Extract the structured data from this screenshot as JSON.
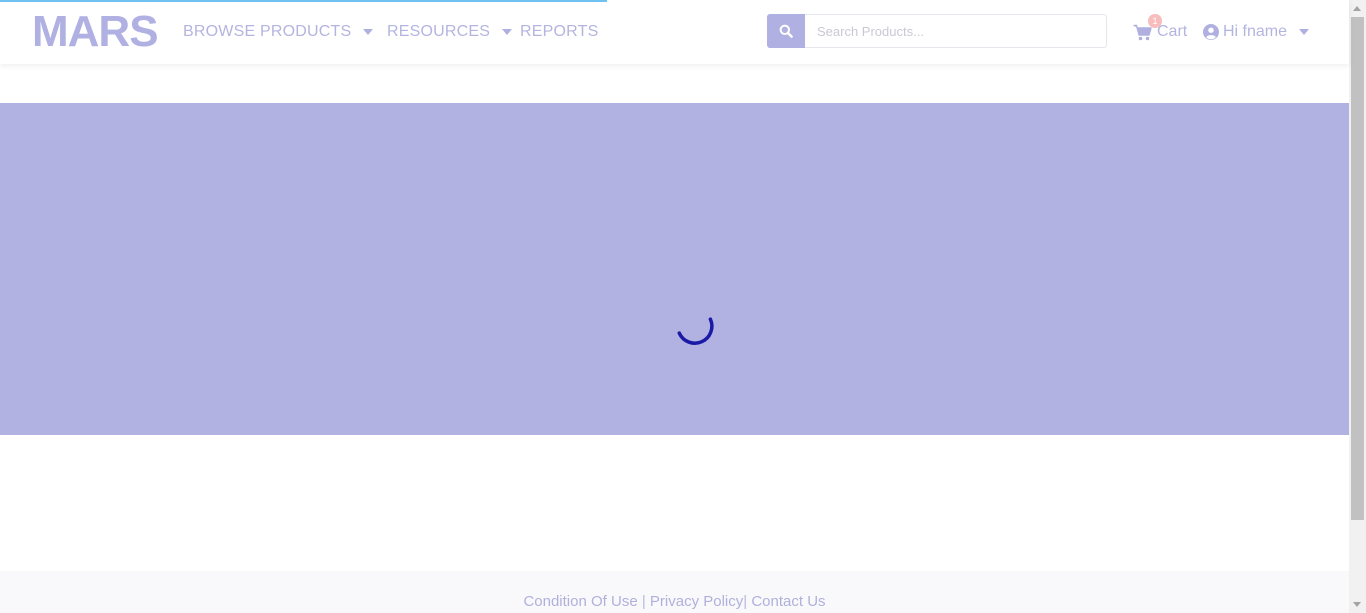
{
  "header": {
    "logo": "MARS",
    "nav": [
      {
        "label": "BROWSE PRODUCTS",
        "has_dropdown": true
      },
      {
        "label": "RESOURCES",
        "has_dropdown": true
      },
      {
        "label": "REPORTS",
        "has_dropdown": false
      }
    ],
    "search": {
      "placeholder": "Search Products...",
      "value": "",
      "icon": "search-icon"
    },
    "cart": {
      "label": "Cart",
      "count": "1",
      "icon": "shopping-cart-icon"
    },
    "user": {
      "label": "Hi fname",
      "icon": "user-circle-icon"
    }
  },
  "page_progress": 0.45,
  "main": {
    "state": "loading",
    "icon": "loading-spinner-icon"
  },
  "footer": {
    "links": [
      "Condition Of Use",
      "Privacy Policy",
      "Contact Us"
    ],
    "separators": [
      " | ",
      "| "
    ]
  },
  "colors": {
    "brand": "#b0b0e2",
    "panel": "#b1b1e2",
    "spinner": "#1a1aa6",
    "progress": "#6ec1f0",
    "badge": "#f8bcbc"
  }
}
